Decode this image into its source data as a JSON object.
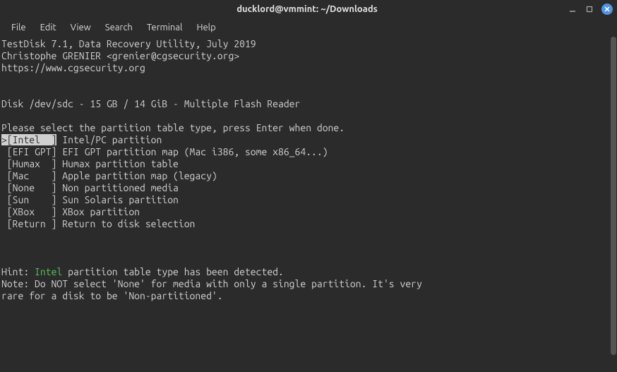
{
  "titlebar": {
    "title": "ducklord@vmmint: ~/Downloads"
  },
  "menubar": {
    "file": "File",
    "edit": "Edit",
    "view": "View",
    "search": "Search",
    "terminal": "Terminal",
    "help": "Help"
  },
  "term": {
    "line1": "TestDisk 7.1, Data Recovery Utility, July 2019",
    "line2": "Christophe GRENIER <grenier@cgsecurity.org>",
    "line3": "https://www.cgsecurity.org",
    "disk": "Disk /dev/sdc - 15 GB / 14 GiB - Multiple Flash Reader",
    "prompt": "Please select the partition table type, press Enter when done.",
    "opt_intel_marker": ">",
    "opt_intel_label": "[Intel  ]",
    "opt_intel_desc": " Intel/PC partition",
    "opt_efi": " [EFI GPT] EFI GPT partition map (Mac i386, some x86_64...)",
    "opt_humax": " [Humax  ] Humax partition table",
    "opt_mac": " [Mac    ] Apple partition map (legacy)",
    "opt_none": " [None   ] Non partitioned media",
    "opt_sun": " [Sun    ] Sun Solaris partition",
    "opt_xbox": " [XBox   ] XBox partition",
    "opt_return": " [Return ] Return to disk selection",
    "hint_pre": "Hint: ",
    "hint_detected": "Intel",
    "hint_post": " partition table type has been detected.",
    "note1": "Note: Do NOT select 'None' for media with only a single partition. It's very",
    "note2": "rare for a disk to be 'Non-partitioned'."
  }
}
